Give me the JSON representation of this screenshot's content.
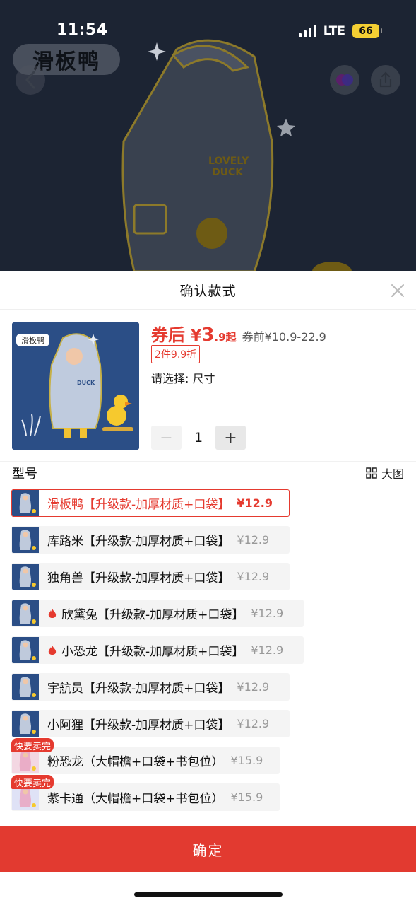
{
  "status_bar": {
    "time": "11:54",
    "network": "LTE",
    "battery": "66"
  },
  "backdrop": {
    "shop_name": "滑板鸭"
  },
  "sheet": {
    "title": "确认款式",
    "product": {
      "thumb_tag": "滑板鸭",
      "price_label": "券后",
      "price_symbol": "¥",
      "price_int": "3",
      "price_dec": ".9",
      "price_suffix": "起",
      "original_price": "券前¥10.9-22.9",
      "promo": "2件9.9折",
      "select_hint": "请选择: 尺寸",
      "quantity": "1",
      "minus": "−",
      "plus": "+"
    },
    "section_title": "型号",
    "big_image_label": "大图",
    "options": [
      {
        "name": "滑板鸭【升级款-加厚材质+口袋】",
        "price": "¥12.9",
        "selected": true,
        "hot": false,
        "badge": ""
      },
      {
        "name": "库路米【升级款-加厚材质+口袋】",
        "price": "¥12.9",
        "selected": false,
        "hot": false,
        "badge": ""
      },
      {
        "name": "独角兽【升级款-加厚材质+口袋】",
        "price": "¥12.9",
        "selected": false,
        "hot": false,
        "badge": ""
      },
      {
        "name": "欣黛兔【升级款-加厚材质+口袋】",
        "price": "¥12.9",
        "selected": false,
        "hot": true,
        "badge": ""
      },
      {
        "name": "小恐龙【升级款-加厚材质+口袋】",
        "price": "¥12.9",
        "selected": false,
        "hot": true,
        "badge": ""
      },
      {
        "name": "宇航员【升级款-加厚材质+口袋】",
        "price": "¥12.9",
        "selected": false,
        "hot": false,
        "badge": ""
      },
      {
        "name": "小阿狸【升级款-加厚材质+口袋】",
        "price": "¥12.9",
        "selected": false,
        "hot": false,
        "badge": ""
      },
      {
        "name": "粉恐龙（大帽檐+口袋+书包位）",
        "price": "¥15.9",
        "selected": false,
        "hot": false,
        "badge": "快要卖完"
      },
      {
        "name": "紫卡通（大帽檐+口袋+书包位）",
        "price": "¥15.9",
        "selected": false,
        "hot": false,
        "badge": "快要卖完"
      }
    ],
    "confirm_label": "确定"
  },
  "colors": {
    "accent": "#e53a2f",
    "confirm": "#e23a30",
    "backdrop": "#1c2433"
  }
}
